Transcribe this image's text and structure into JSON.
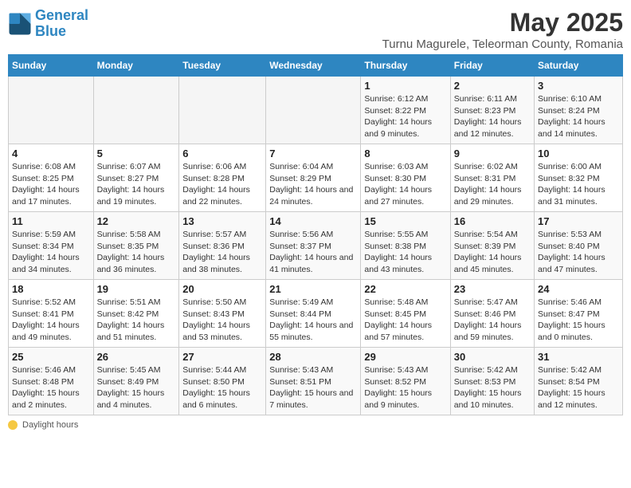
{
  "header": {
    "logo_line1": "General",
    "logo_line2": "Blue",
    "main_title": "May 2025",
    "subtitle": "Turnu Magurele, Teleorman County, Romania"
  },
  "calendar": {
    "columns": [
      "Sunday",
      "Monday",
      "Tuesday",
      "Wednesday",
      "Thursday",
      "Friday",
      "Saturday"
    ],
    "weeks": [
      [
        {
          "day": "",
          "info": ""
        },
        {
          "day": "",
          "info": ""
        },
        {
          "day": "",
          "info": ""
        },
        {
          "day": "",
          "info": ""
        },
        {
          "day": "1",
          "info": "Sunrise: 6:12 AM\nSunset: 8:22 PM\nDaylight: 14 hours and 9 minutes."
        },
        {
          "day": "2",
          "info": "Sunrise: 6:11 AM\nSunset: 8:23 PM\nDaylight: 14 hours and 12 minutes."
        },
        {
          "day": "3",
          "info": "Sunrise: 6:10 AM\nSunset: 8:24 PM\nDaylight: 14 hours and 14 minutes."
        }
      ],
      [
        {
          "day": "4",
          "info": "Sunrise: 6:08 AM\nSunset: 8:25 PM\nDaylight: 14 hours and 17 minutes."
        },
        {
          "day": "5",
          "info": "Sunrise: 6:07 AM\nSunset: 8:27 PM\nDaylight: 14 hours and 19 minutes."
        },
        {
          "day": "6",
          "info": "Sunrise: 6:06 AM\nSunset: 8:28 PM\nDaylight: 14 hours and 22 minutes."
        },
        {
          "day": "7",
          "info": "Sunrise: 6:04 AM\nSunset: 8:29 PM\nDaylight: 14 hours and 24 minutes."
        },
        {
          "day": "8",
          "info": "Sunrise: 6:03 AM\nSunset: 8:30 PM\nDaylight: 14 hours and 27 minutes."
        },
        {
          "day": "9",
          "info": "Sunrise: 6:02 AM\nSunset: 8:31 PM\nDaylight: 14 hours and 29 minutes."
        },
        {
          "day": "10",
          "info": "Sunrise: 6:00 AM\nSunset: 8:32 PM\nDaylight: 14 hours and 31 minutes."
        }
      ],
      [
        {
          "day": "11",
          "info": "Sunrise: 5:59 AM\nSunset: 8:34 PM\nDaylight: 14 hours and 34 minutes."
        },
        {
          "day": "12",
          "info": "Sunrise: 5:58 AM\nSunset: 8:35 PM\nDaylight: 14 hours and 36 minutes."
        },
        {
          "day": "13",
          "info": "Sunrise: 5:57 AM\nSunset: 8:36 PM\nDaylight: 14 hours and 38 minutes."
        },
        {
          "day": "14",
          "info": "Sunrise: 5:56 AM\nSunset: 8:37 PM\nDaylight: 14 hours and 41 minutes."
        },
        {
          "day": "15",
          "info": "Sunrise: 5:55 AM\nSunset: 8:38 PM\nDaylight: 14 hours and 43 minutes."
        },
        {
          "day": "16",
          "info": "Sunrise: 5:54 AM\nSunset: 8:39 PM\nDaylight: 14 hours and 45 minutes."
        },
        {
          "day": "17",
          "info": "Sunrise: 5:53 AM\nSunset: 8:40 PM\nDaylight: 14 hours and 47 minutes."
        }
      ],
      [
        {
          "day": "18",
          "info": "Sunrise: 5:52 AM\nSunset: 8:41 PM\nDaylight: 14 hours and 49 minutes."
        },
        {
          "day": "19",
          "info": "Sunrise: 5:51 AM\nSunset: 8:42 PM\nDaylight: 14 hours and 51 minutes."
        },
        {
          "day": "20",
          "info": "Sunrise: 5:50 AM\nSunset: 8:43 PM\nDaylight: 14 hours and 53 minutes."
        },
        {
          "day": "21",
          "info": "Sunrise: 5:49 AM\nSunset: 8:44 PM\nDaylight: 14 hours and 55 minutes."
        },
        {
          "day": "22",
          "info": "Sunrise: 5:48 AM\nSunset: 8:45 PM\nDaylight: 14 hours and 57 minutes."
        },
        {
          "day": "23",
          "info": "Sunrise: 5:47 AM\nSunset: 8:46 PM\nDaylight: 14 hours and 59 minutes."
        },
        {
          "day": "24",
          "info": "Sunrise: 5:46 AM\nSunset: 8:47 PM\nDaylight: 15 hours and 0 minutes."
        }
      ],
      [
        {
          "day": "25",
          "info": "Sunrise: 5:46 AM\nSunset: 8:48 PM\nDaylight: 15 hours and 2 minutes."
        },
        {
          "day": "26",
          "info": "Sunrise: 5:45 AM\nSunset: 8:49 PM\nDaylight: 15 hours and 4 minutes."
        },
        {
          "day": "27",
          "info": "Sunrise: 5:44 AM\nSunset: 8:50 PM\nDaylight: 15 hours and 6 minutes."
        },
        {
          "day": "28",
          "info": "Sunrise: 5:43 AM\nSunset: 8:51 PM\nDaylight: 15 hours and 7 minutes."
        },
        {
          "day": "29",
          "info": "Sunrise: 5:43 AM\nSunset: 8:52 PM\nDaylight: 15 hours and 9 minutes."
        },
        {
          "day": "30",
          "info": "Sunrise: 5:42 AM\nSunset: 8:53 PM\nDaylight: 15 hours and 10 minutes."
        },
        {
          "day": "31",
          "info": "Sunrise: 5:42 AM\nSunset: 8:54 PM\nDaylight: 15 hours and 12 minutes."
        }
      ]
    ]
  },
  "footer": {
    "daylight_label": "Daylight hours"
  }
}
